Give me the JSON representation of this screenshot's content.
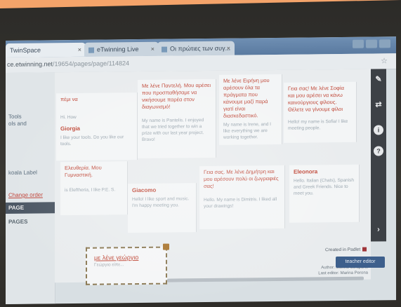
{
  "browser": {
    "tabs": [
      {
        "label": "TwinSpace",
        "active": true
      },
      {
        "label": "eTwinning Live",
        "active": false
      },
      {
        "label": "Οι πρώτιες των συγ...",
        "active": false
      }
    ],
    "url_host": "ce.etwinning.net",
    "url_path": "/19654/pages/page/114824",
    "tab_close": "×"
  },
  "sidebar": {
    "tools_label": "Tools",
    "tools_sub": "ols and",
    "label_item": "koala Label",
    "change_order": "Change order",
    "page_active": "PAGE",
    "pages": "PAGES"
  },
  "wall": {
    "notes": [
      {
        "gr": "πέμι να",
        "en": "Hi. How",
        "name": "Giorgia",
        "en2": "I like your tools. Do you like our tools."
      },
      {
        "gr": "Με λένε Παντελή. Μου αρέσει που προσπαθήσαμε να νικήσουμε παρέα στον διαγωνισμό!",
        "en": "My name is Pantelis. I enjoyed that we tried together to win a prize with our last year project. Bravo!"
      },
      {
        "gr": "Με λένε Ειρήνη μου αρέσουν όλα τα πράγματα που κάνουμε μαζί παρά γιατί είναι διασκεδαστικό.",
        "en": "My name is Irene, and I like everything we are working together."
      },
      {
        "gr": "Γεια σας! Με λένε Σοφία και μου αρέσει να κάνω καινούργιους φίλους. Θέλετε να γίνουμε φίλοι",
        "en": "Hello! my name is Sofia! I like meeting people."
      },
      {
        "gr": "Ελευθερία. Μου Γυμναστική.",
        "en": "is Eleftheria, I like P.E. S."
      },
      {
        "name": "Giacomo",
        "en": "Hello! I like sport and music. I'm happy meeting you."
      },
      {
        "gr": "Γεια σας. Με λένε Δημήτρη και μου αρέσουν πολύ οι ζωγραφιές σας!",
        "en": "Hello. My name is Dimitris. I liked all your drawings!"
      },
      {
        "name": "Eleonora",
        "en": "Hello. Italian (Chats), Spanish and Greek Friends. Nice to meet you."
      }
    ],
    "draft_text": "με λένε γεώργιο",
    "draft_sub": "Γεώργιο είπε..."
  },
  "toolbar": {
    "items": [
      "pencil-icon",
      "share-icon",
      "info-icon",
      "help-icon"
    ]
  },
  "created": "Created in Padlet",
  "footer": {
    "author": "Author: Marina Scrapardi",
    "editor": "Last editor: Marina Perona"
  },
  "cta": "teacher editor"
}
